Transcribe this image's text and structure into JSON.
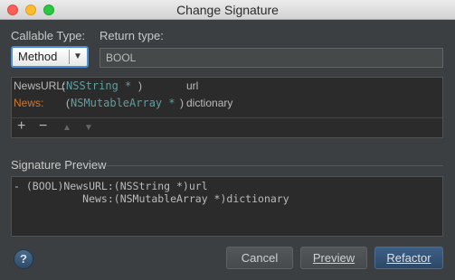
{
  "window": {
    "title": "Change Signature"
  },
  "callable_type": {
    "label": "Callable Type:",
    "selected": "Method"
  },
  "return_type": {
    "label": "Return type:",
    "value": "BOOL"
  },
  "params": [
    {
      "name": "NewsURL:",
      "open": "(",
      "type": "NSString *",
      "close": ")",
      "arg": "url",
      "highlighted": false
    },
    {
      "name": "News:",
      "open": "(",
      "type": "NSMutableArray *",
      "close": ")",
      "arg": "dictionary",
      "highlighted": true
    }
  ],
  "param_toolbar": {
    "add": "+",
    "remove": "−",
    "up": "▲",
    "down": "▼"
  },
  "preview": {
    "title": "Signature Preview",
    "line1": "- (BOOL)NewsURL:(NSString *)url",
    "line2": "           News:(NSMutableArray *)dictionary"
  },
  "buttons": {
    "help": "?",
    "cancel": "Cancel",
    "preview": "Preview",
    "refactor": "Refactor"
  },
  "colors": {
    "background": "#3c3f41",
    "accent": "#4b8fd4",
    "param_highlight": "#cc7832",
    "type_color": "#5f9ea0"
  }
}
